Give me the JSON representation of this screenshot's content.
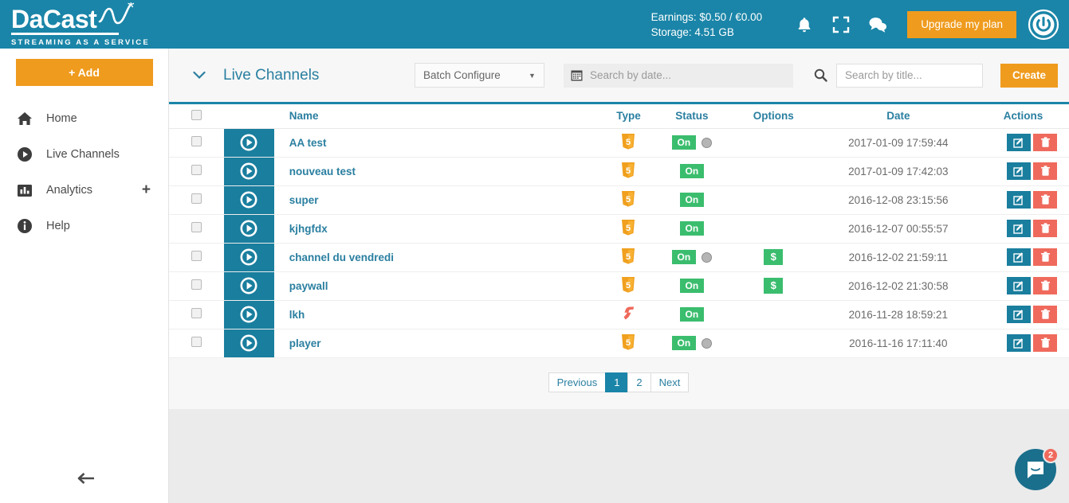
{
  "header": {
    "logo_text": "DaCast",
    "logo_tagline": "STREAMING AS A SERVICE",
    "earnings_line": "Earnings: $0.50 / €0.00",
    "storage_line": "Storage: 4.51 GB",
    "notification_icon": "bell-icon",
    "fullscreen_icon": "fullscreen-icon",
    "chat_icon": "chat-bubble-icon",
    "upgrade_label": "Upgrade my plan",
    "power_icon": "power-icon",
    "accent_teal": "#1a85a8",
    "accent_orange": "#ef9b1e"
  },
  "sidebar": {
    "add_label": "+ Add",
    "items": [
      {
        "label": "Home",
        "icon": "home-icon"
      },
      {
        "label": "Live Channels",
        "icon": "play-circle-icon"
      },
      {
        "label": "Analytics",
        "icon": "bar-chart-icon",
        "has_plus": true
      },
      {
        "label": "Help",
        "icon": "info-circle-icon"
      }
    ],
    "collapse_icon": "arrow-left-icon"
  },
  "toolbar": {
    "collapse_caret_icon": "chevron-down-icon",
    "title": "Live Channels",
    "batch_label": "Batch Configure",
    "batch_caret_icon": "caret-down-icon",
    "date_icon": "calendar-icon",
    "date_placeholder": "Search by date...",
    "date_value": "",
    "search_icon": "magnifier-icon",
    "title_placeholder": "Search by title...",
    "title_value": "",
    "create_label": "Create"
  },
  "table": {
    "columns": {
      "name": "Name",
      "type": "Type",
      "status": "Status",
      "options": "Options",
      "date": "Date",
      "actions": "Actions"
    },
    "rows": [
      {
        "name": "AA test",
        "type": "html5",
        "status": "On",
        "rec": true,
        "paywall": false,
        "date": "2017-01-09 17:59:44"
      },
      {
        "name": "nouveau test",
        "type": "html5",
        "status": "On",
        "rec": false,
        "paywall": false,
        "date": "2017-01-09 17:42:03"
      },
      {
        "name": "super",
        "type": "html5",
        "status": "On",
        "rec": false,
        "paywall": false,
        "date": "2016-12-08 23:15:56"
      },
      {
        "name": "kjhgfdx",
        "type": "html5",
        "status": "On",
        "rec": false,
        "paywall": false,
        "date": "2016-12-07 00:55:57"
      },
      {
        "name": "channel du vendredi",
        "type": "html5",
        "status": "On",
        "rec": true,
        "paywall": true,
        "date": "2016-12-02 21:59:11"
      },
      {
        "name": "paywall",
        "type": "html5",
        "status": "On",
        "rec": false,
        "paywall": true,
        "date": "2016-12-02 21:30:58"
      },
      {
        "name": "lkh",
        "type": "flash",
        "status": "On",
        "rec": false,
        "paywall": false,
        "date": "2016-11-28 18:59:21"
      },
      {
        "name": "player",
        "type": "html5",
        "status": "On",
        "rec": true,
        "paywall": false,
        "date": "2016-11-16 17:11:40"
      }
    ],
    "paywall_symbol": "$",
    "thumb_icon": "play-circle-icon",
    "edit_icon": "pencil-square-icon",
    "delete_icon": "trash-icon"
  },
  "pagination": {
    "previous": "Previous",
    "pages": [
      "1",
      "2"
    ],
    "active_page": "1",
    "next": "Next"
  },
  "intercom": {
    "icon": "messenger-icon",
    "badge": "2"
  }
}
